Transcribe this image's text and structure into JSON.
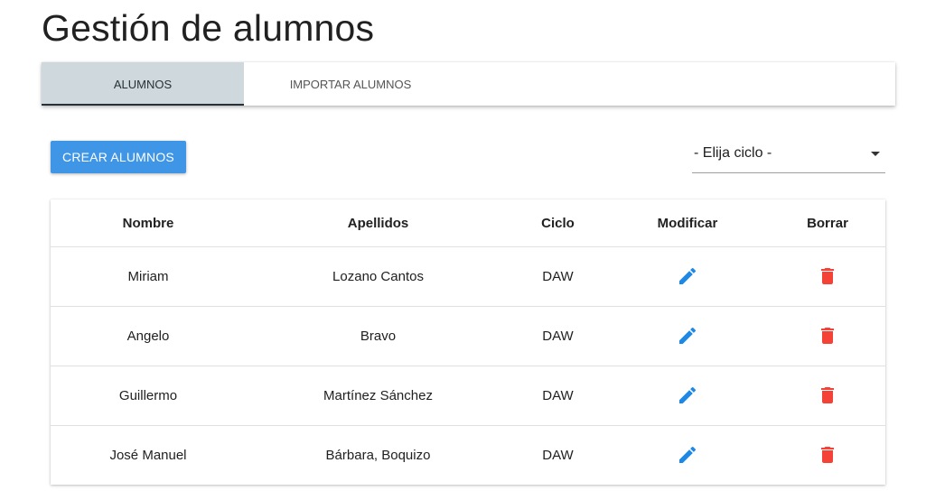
{
  "page_title": "Gestión de alumnos",
  "tabs": [
    {
      "label": "ALUMNOS",
      "active": true
    },
    {
      "label": "IMPORTAR ALUMNOS",
      "active": false
    }
  ],
  "toolbar": {
    "create_label": "CREAR ALUMNOS",
    "ciclo_select": {
      "value": "- Elija ciclo -"
    }
  },
  "table": {
    "headers": {
      "nombre": "Nombre",
      "apellidos": "Apellidos",
      "ciclo": "Ciclo",
      "modificar": "Modificar",
      "borrar": "Borrar"
    },
    "rows": [
      {
        "nombre": "Miriam",
        "apellidos": "Lozano Cantos",
        "ciclo": "DAW"
      },
      {
        "nombre": "Angelo",
        "apellidos": "Bravo",
        "ciclo": "DAW"
      },
      {
        "nombre": "Guillermo",
        "apellidos": "Martínez Sánchez",
        "ciclo": "DAW"
      },
      {
        "nombre": "José Manuel",
        "apellidos": "Bárbara, Boquizo",
        "ciclo": "DAW"
      }
    ]
  },
  "icons": {
    "edit": "pencil-icon",
    "delete": "trash-icon",
    "select_arrow": "caret-down-icon"
  },
  "colors": {
    "primary_button": "#3f96e6",
    "active_tab_bg": "#cfd8dc",
    "edit_icon": "#1e88e5",
    "delete_icon": "#f44336"
  }
}
